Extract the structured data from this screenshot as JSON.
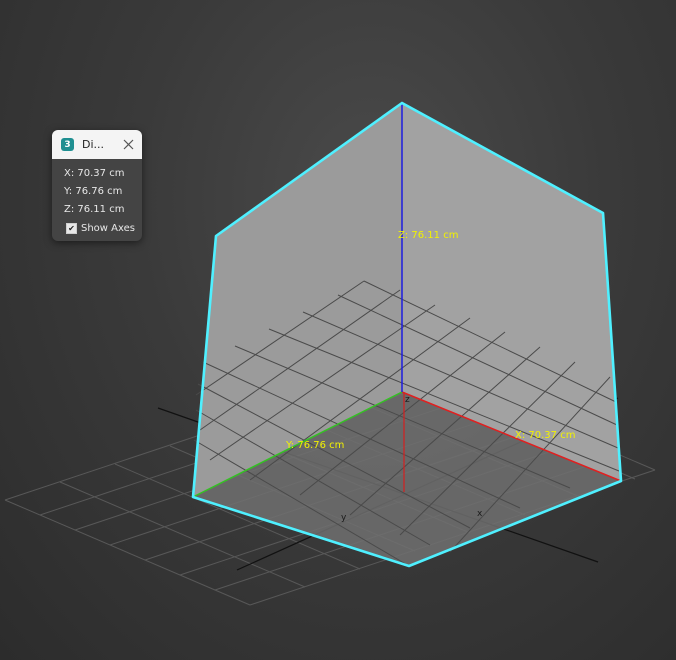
{
  "dimensions_panel": {
    "title": "Di...",
    "app_icon_text": "3",
    "x_readout": "X: 70.37 cm",
    "y_readout": "Y: 76.76 cm",
    "z_readout": "Z: 76.11 cm",
    "show_axes_label": "Show Axes",
    "show_axes_checked": true
  },
  "viewport": {
    "x_dimension_label": "X: 70.37 cm",
    "y_dimension_label": "Y: 76.76 cm",
    "z_dimension_label": "Z: 76.11 cm",
    "axis_tick_x": "x",
    "axis_tick_y": "y",
    "axis_tick_z": "z",
    "colors": {
      "selection_outline": "#4ff0ff",
      "x_axis": "#e02020",
      "y_axis": "#35c024",
      "z_axis": "#1d1de0",
      "dimension_text": "#f2f200"
    }
  }
}
